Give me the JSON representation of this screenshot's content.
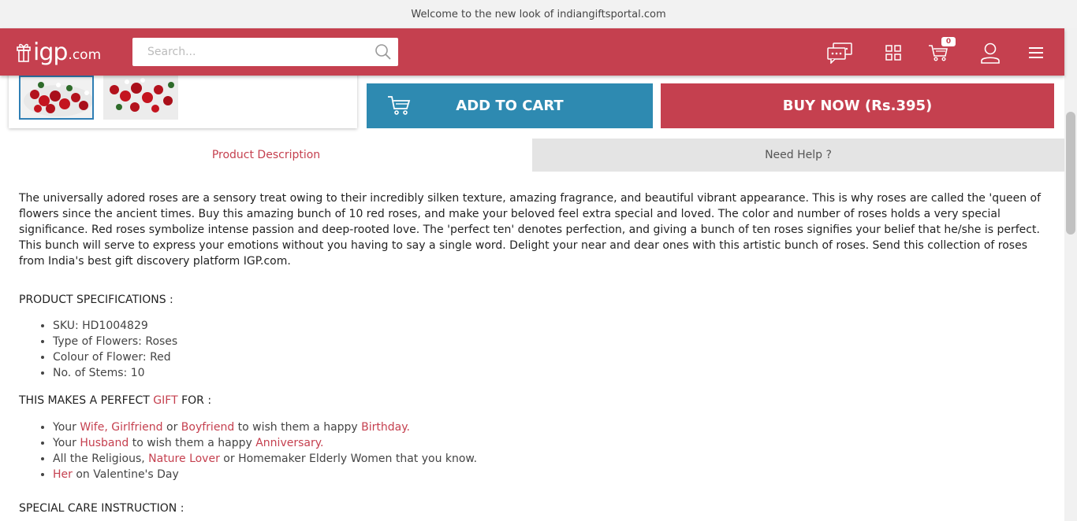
{
  "topbar": {
    "message": "Welcome to the new look of indiangiftsportal.com"
  },
  "header": {
    "logo_text": "igp",
    "logo_suffix": ".com",
    "search_placeholder": "Search...",
    "cart_count": "0",
    "icons": [
      "chat-icon",
      "grid-icon",
      "cart-icon",
      "user-icon",
      "menu-icon"
    ],
    "brand_color": "#c5404f"
  },
  "actions": {
    "add_to_cart": "ADD TO CART",
    "buy_now": "BUY NOW (Rs.395)",
    "cart_color": "#2e8ab1"
  },
  "tabs": [
    {
      "label": "Product Description",
      "active": true
    },
    {
      "label": "Need Help ?",
      "active": false
    }
  ],
  "description": "The universally adored roses are a sensory treat owing to their incredibly silken texture, amazing fragrance, and beautiful vibrant appearance. This is why roses are called the 'queen of flowers since the ancient times. Buy this amazing bunch of 10 red roses, and make your beloved feel extra special and loved. The color and number of roses holds a very special significance. Red roses symbolize intense passion and deep-rooted love. The 'perfect ten' denotes perfection, and giving a bunch of ten roses signifies your belief that he/she is perfect. This bunch will serve to express your emotions without you having to say a single word. Delight your near and dear ones with this artistic bunch of roses. Send this collection of roses from India's best gift discovery platform IGP.com.",
  "specs": {
    "title": "PRODUCT SPECIFICATIONS :",
    "items": [
      "SKU: HD1004829",
      "Type of Flowers: Roses",
      "Colour of Flower: Red",
      "No. of Stems: 10"
    ]
  },
  "perfect_gift": {
    "title_before": "THIS MAKES A PERFECT ",
    "title_link": "GIFT",
    "title_after": " FOR :",
    "line1": {
      "a": "Your ",
      "b": "Wife",
      "c": ", ",
      "d": "Girlfriend",
      "e": " or ",
      "f": "Boyfriend",
      "g": " to wish them a happy ",
      "h": "Birthday",
      "i": "."
    },
    "line2": {
      "a": "Your ",
      "b": "Husband",
      "c": " to wish them a happy ",
      "d": "Anniversary",
      "e": "."
    },
    "line3": {
      "a": "All the Religious, ",
      "b": "Nature Lover",
      "c": " or Homemaker Elderly Women that you know."
    },
    "line4": {
      "a": "Her",
      "b": " on Valentine's Day"
    }
  },
  "care": {
    "title": "SPECIAL CARE INSTRUCTION :"
  }
}
